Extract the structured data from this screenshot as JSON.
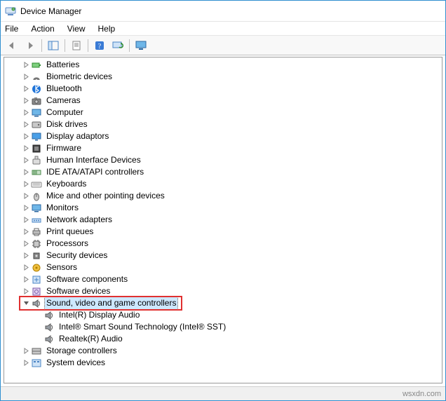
{
  "window": {
    "title": "Device Manager"
  },
  "menu": {
    "file": "File",
    "action": "Action",
    "view": "View",
    "help": "Help"
  },
  "toolbar": {
    "back": "back-icon",
    "forward": "forward-icon",
    "show_hide": "show-hide-tree-icon",
    "properties": "properties-icon",
    "help": "help-icon",
    "scan": "scan-hardware-icon",
    "monitor": "monitor-icon"
  },
  "tree": {
    "items": [
      {
        "label": "Batteries",
        "icon": "battery",
        "expanded": false,
        "depth": 1
      },
      {
        "label": "Biometric devices",
        "icon": "biometric",
        "expanded": false,
        "depth": 1
      },
      {
        "label": "Bluetooth",
        "icon": "bluetooth",
        "expanded": false,
        "depth": 1
      },
      {
        "label": "Cameras",
        "icon": "camera",
        "expanded": false,
        "depth": 1
      },
      {
        "label": "Computer",
        "icon": "computer",
        "expanded": false,
        "depth": 1
      },
      {
        "label": "Disk drives",
        "icon": "disk",
        "expanded": false,
        "depth": 1
      },
      {
        "label": "Display adaptors",
        "icon": "display",
        "expanded": false,
        "depth": 1
      },
      {
        "label": "Firmware",
        "icon": "firmware",
        "expanded": false,
        "depth": 1
      },
      {
        "label": "Human Interface Devices",
        "icon": "hid",
        "expanded": false,
        "depth": 1
      },
      {
        "label": "IDE ATA/ATAPI controllers",
        "icon": "ide",
        "expanded": false,
        "depth": 1
      },
      {
        "label": "Keyboards",
        "icon": "keyboard",
        "expanded": false,
        "depth": 1
      },
      {
        "label": "Mice and other pointing devices",
        "icon": "mouse",
        "expanded": false,
        "depth": 1
      },
      {
        "label": "Monitors",
        "icon": "monitor",
        "expanded": false,
        "depth": 1
      },
      {
        "label": "Network adapters",
        "icon": "network",
        "expanded": false,
        "depth": 1
      },
      {
        "label": "Print queues",
        "icon": "printer",
        "expanded": false,
        "depth": 1
      },
      {
        "label": "Processors",
        "icon": "cpu",
        "expanded": false,
        "depth": 1
      },
      {
        "label": "Security devices",
        "icon": "security",
        "expanded": false,
        "depth": 1
      },
      {
        "label": "Sensors",
        "icon": "sensor",
        "expanded": false,
        "depth": 1
      },
      {
        "label": "Software components",
        "icon": "swcomp",
        "expanded": false,
        "depth": 1
      },
      {
        "label": "Software devices",
        "icon": "swdev",
        "expanded": false,
        "depth": 1
      },
      {
        "label": "Sound, video and game controllers",
        "icon": "sound",
        "expanded": true,
        "depth": 1,
        "selected": true,
        "highlight": true
      },
      {
        "label": "Intel(R) Display Audio",
        "icon": "sound",
        "expanded": null,
        "depth": 2
      },
      {
        "label": "Intel® Smart Sound Technology (Intel® SST)",
        "icon": "sound",
        "expanded": null,
        "depth": 2
      },
      {
        "label": "Realtek(R) Audio",
        "icon": "sound",
        "expanded": null,
        "depth": 2
      },
      {
        "label": "Storage controllers",
        "icon": "storage",
        "expanded": false,
        "depth": 1
      },
      {
        "label": "System devices",
        "icon": "system",
        "expanded": false,
        "depth": 1
      }
    ]
  },
  "status": {
    "watermark": "wsxdn.com"
  },
  "colors": {
    "selection": "#cde8ff",
    "highlight_border": "#e03030",
    "window_border": "#2f8fd0"
  }
}
